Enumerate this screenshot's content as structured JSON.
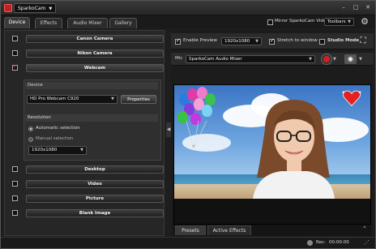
{
  "window": {
    "app_menu_label": "SparkoCam",
    "minimize": "–",
    "maximize": "□",
    "close": "✕"
  },
  "tabs": [
    {
      "label": "Device",
      "active": true
    },
    {
      "label": "Effects",
      "active": false
    },
    {
      "label": "Audio Mixer",
      "active": false
    },
    {
      "label": "Gallery",
      "active": false
    }
  ],
  "topbar": {
    "mirror_label": "Mirror SparkoCam Video",
    "mirror_checked": false,
    "toolbars_label": "Toolbars",
    "gear_icon": "gear-icon"
  },
  "sources": {
    "canon": {
      "label": "Canon Camera",
      "checked": false
    },
    "nikon": {
      "label": "Nikon Camera",
      "checked": false
    },
    "webcam": {
      "label": "Webcam",
      "checked": true
    },
    "desktop": {
      "label": "Desktop",
      "checked": false
    },
    "video": {
      "label": "Video",
      "checked": false
    },
    "picture": {
      "label": "Picture",
      "checked": false
    },
    "blank": {
      "label": "Blank Image",
      "checked": false
    }
  },
  "device_section": {
    "device_header": "Device",
    "device_value": "HD Pro Webcam C920",
    "properties_label": "Properties",
    "resolution_header": "Resolution",
    "auto_label": "Automatic selection",
    "manual_label": "Manual selection",
    "selected_mode": "auto",
    "manual_resolution": "1920x1080"
  },
  "preview_controls": {
    "enable_preview_label": "Enable Preview",
    "enable_preview_checked": true,
    "resolution_value": "1920x1080",
    "stretch_label": "Stretch to window",
    "stretch_checked": true,
    "studio_mode_label": "Studio Mode",
    "studio_mode_checked": false,
    "fullscreen_icon": "fullscreen-icon"
  },
  "mic": {
    "label": "Mic",
    "value": "SparkoCam Audio Mixer",
    "record_icon": "record-icon",
    "snapshot_icon": "camera-icon"
  },
  "bottom_tabs": [
    {
      "label": "Presets",
      "active": true
    },
    {
      "label": "Active Effects",
      "active": false
    }
  ],
  "status": {
    "rec_label": "Rec:",
    "rec_time": "00:00:00"
  },
  "colors": {
    "accent_red": "#d42020",
    "panel_bg": "#262626",
    "window_bg": "#1e1e1e"
  }
}
